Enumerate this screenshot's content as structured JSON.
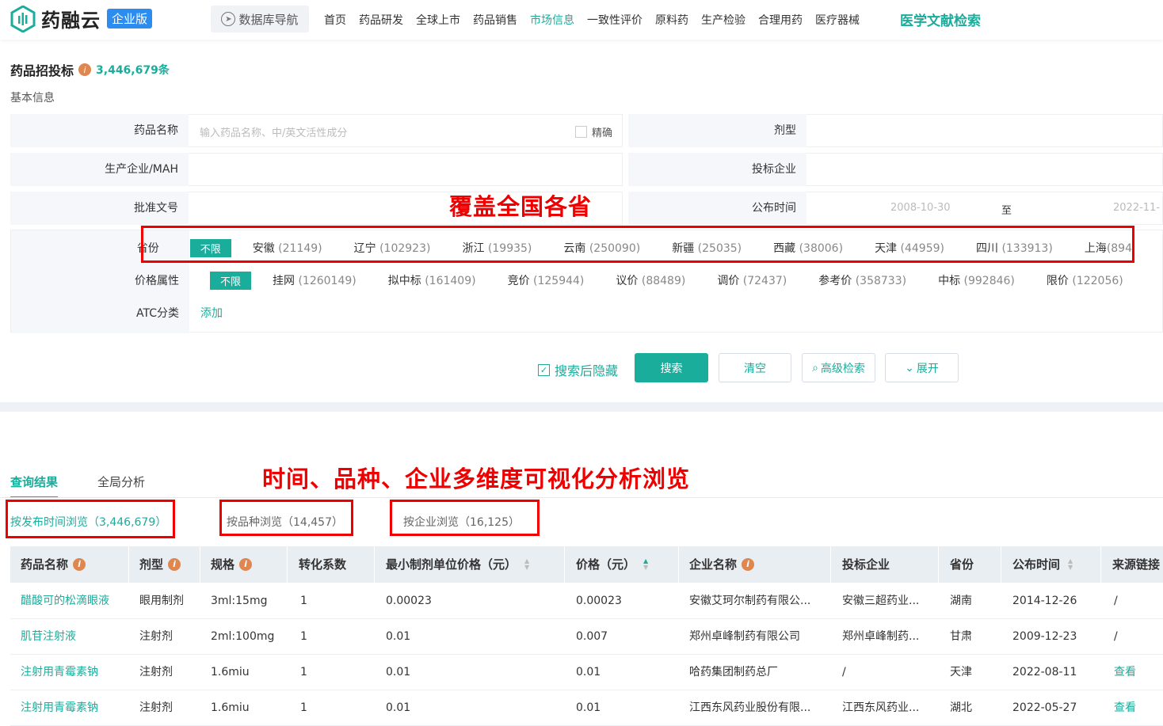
{
  "header": {
    "logo_text": "药融云",
    "edition": "企业版",
    "db_nav": "数据库导航",
    "nav": [
      "首页",
      "药品研发",
      "全球上市",
      "药品销售",
      "市场信息",
      "一致性评价",
      "原料药",
      "生产检验",
      "合理用药",
      "医疗器械"
    ],
    "active_nav": "市场信息",
    "literature": "医学文献检索"
  },
  "page": {
    "title": "药品招投标",
    "count": "3,446,679条",
    "section": "基本信息"
  },
  "form": {
    "drug_name_label": "药品名称",
    "drug_name_placeholder": "输入药品名称、中/英文活性成分",
    "exact_label": "精确",
    "dosage_label": "剂型",
    "manufacturer_label": "生产企业/MAH",
    "bidder_label": "投标企业",
    "approval_label": "批准文号",
    "publish_label": "公布时间",
    "date_from": "2008-10-30",
    "date_to_sep": "至",
    "date_to": "2022-11-",
    "province_label": "省份",
    "price_label": "价格属性",
    "atc_label": "ATC分类",
    "unlimited": "不限",
    "atc_add": "添加",
    "provinces": [
      {
        "name": "安徽",
        "count": "(21149)"
      },
      {
        "name": "辽宁",
        "count": "(102923)"
      },
      {
        "name": "浙江",
        "count": "(19935)"
      },
      {
        "name": "云南",
        "count": "(250090)"
      },
      {
        "name": "新疆",
        "count": "(25035)"
      },
      {
        "name": "西藏",
        "count": "(38006)"
      },
      {
        "name": "天津",
        "count": "(44959)"
      },
      {
        "name": "四川",
        "count": "(133913)"
      },
      {
        "name": "上海",
        "count": "(894"
      }
    ],
    "prices": [
      {
        "name": "挂网",
        "count": "(1260149)"
      },
      {
        "name": "拟中标",
        "count": "(161409)"
      },
      {
        "name": "竞价",
        "count": "(125944)"
      },
      {
        "name": "议价",
        "count": "(88489)"
      },
      {
        "name": "调价",
        "count": "(72437)"
      },
      {
        "name": "参考价",
        "count": "(358733)"
      },
      {
        "name": "中标",
        "count": "(992846)"
      },
      {
        "name": "限价",
        "count": "(122056)"
      }
    ]
  },
  "buttons": {
    "hide_after_search": "搜索后隐藏",
    "search": "搜索",
    "clear": "清空",
    "advanced": "高级检索",
    "expand": "展开"
  },
  "tabs": {
    "results": "查询结果",
    "analysis": "全局分析"
  },
  "browse": {
    "by_time": "按发布时间浏览（3,446,679）",
    "by_variety": "按品种浏览（14,457）",
    "by_company": "按企业浏览（16,125）"
  },
  "annotations": {
    "provinces_note": "覆盖全国各省",
    "analysis_note": "时间、品种、企业多维度可视化分析浏览"
  },
  "table": {
    "headers": [
      "药品名称",
      "剂型",
      "规格",
      "转化系数",
      "最小制剂单位价格（元）",
      "价格（元）",
      "企业名称",
      "投标企业",
      "省份",
      "公布时间",
      "来源链接"
    ],
    "rows": [
      [
        "醋酸可的松滴眼液",
        "眼用制剂",
        "3ml:15mg",
        "1",
        "0.00023",
        "0.00023",
        "安徽艾珂尔制药有限公...",
        "安徽三超药业...",
        "湖南",
        "2014-12-26",
        "/"
      ],
      [
        "肌苷注射液",
        "注射剂",
        "2ml:100mg",
        "1",
        "0.01",
        "0.007",
        "郑州卓峰制药有限公司",
        "郑州卓峰制药...",
        "甘肃",
        "2009-12-23",
        "/"
      ],
      [
        "注射用青霉素钠",
        "注射剂",
        "1.6miu",
        "1",
        "0.01",
        "0.01",
        "哈药集团制药总厂",
        "/",
        "天津",
        "2022-08-11",
        "查看"
      ],
      [
        "注射用青霉素钠",
        "注射剂",
        "1.6miu",
        "1",
        "0.01",
        "0.01",
        "江西东风药业股份有限...",
        "江西东风药业...",
        "湖北",
        "2022-05-27",
        "查看"
      ]
    ]
  },
  "colors": {
    "accent": "#1aad9c",
    "annotation": "#ee0000",
    "info": "#e0864f"
  }
}
